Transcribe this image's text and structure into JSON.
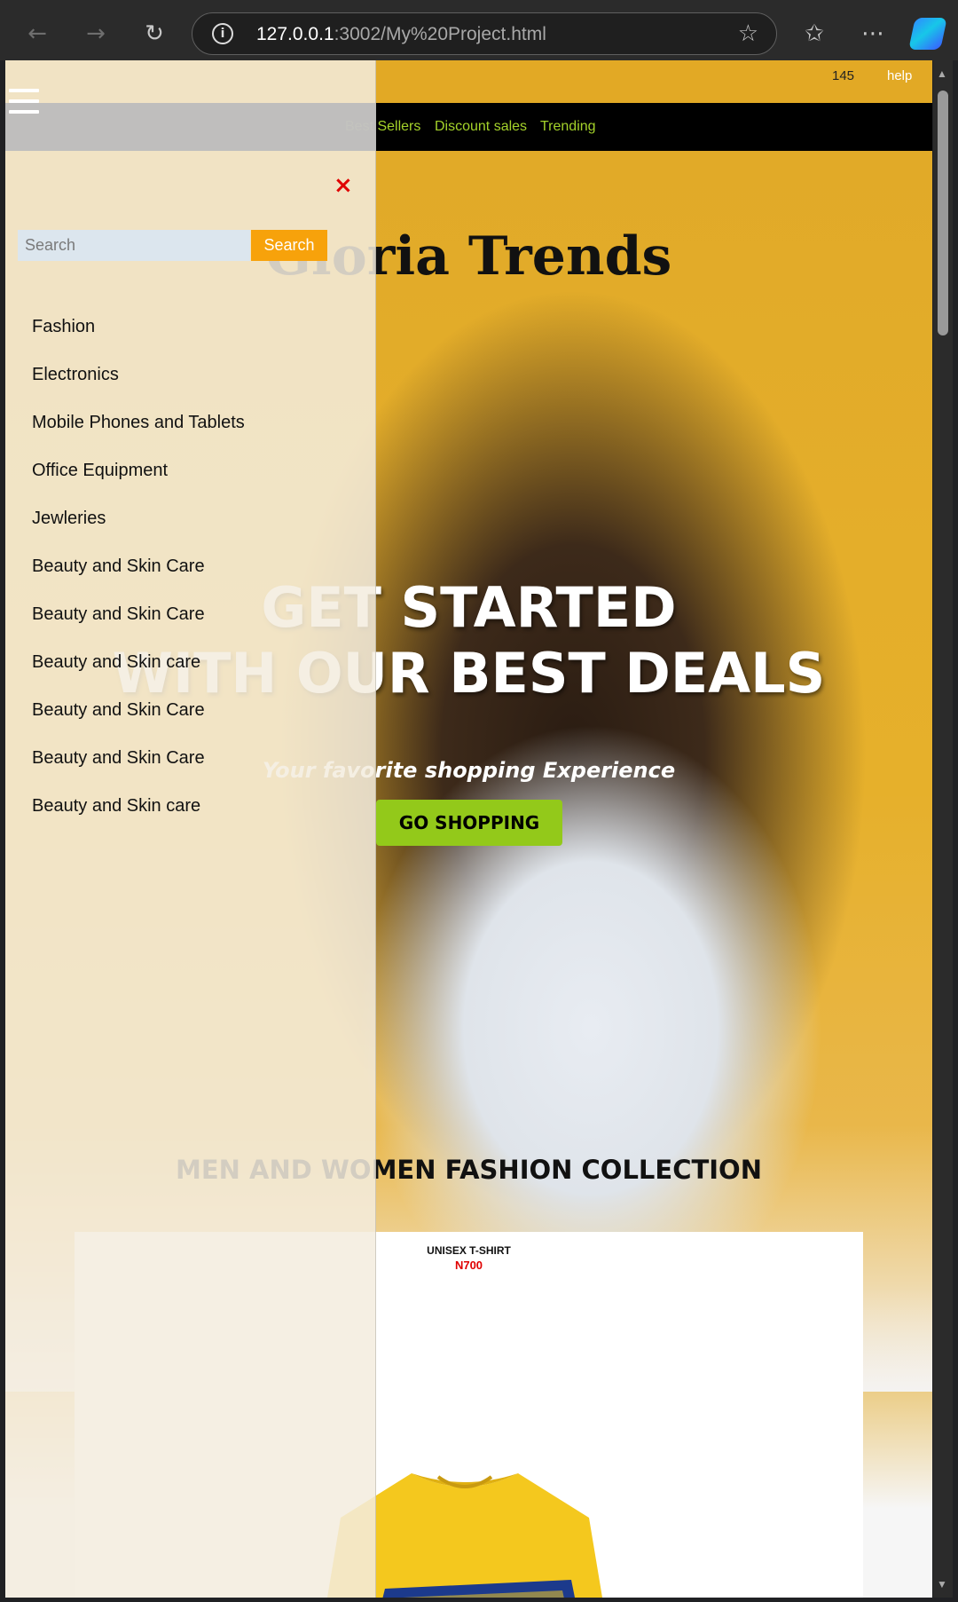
{
  "browser": {
    "url_host": "127.0.0.1",
    "url_path": ":3002/My%20Project.html",
    "icons": [
      "back-icon",
      "forward-icon",
      "refresh-icon",
      "info-icon",
      "favorite-star-icon",
      "favorites-icon",
      "more-icon",
      "copilot-icon"
    ]
  },
  "topbar": {
    "count": "145",
    "help": "help"
  },
  "navbar": {
    "links": [
      "Best Sellers",
      "Discount sales",
      "Trending"
    ]
  },
  "hero": {
    "brand": "Gloria Trends",
    "headline_line1": "GET STARTED",
    "headline_line2": "WITH OUR BEST DEALS",
    "tagline": "Your favorite shopping Experience",
    "cta": "GO SHOPPING"
  },
  "collection": {
    "title": "MEN AND WOMEN FASHION COLLECTION",
    "product": {
      "name": "UNISEX T-SHIRT",
      "price": "N700"
    }
  },
  "side_menu": {
    "close": "×",
    "search_placeholder": "Search",
    "search_button": "Search",
    "categories": [
      "Fashion",
      "Electronics",
      "Mobile Phones and Tablets",
      "Office Equipment",
      "Jewleries",
      "Beauty and Skin Care",
      "Beauty and Skin Care",
      "Beauty and Skin care",
      "Beauty and Skin Care",
      "Beauty and Skin Care",
      "Beauty and Skin care"
    ]
  },
  "colors": {
    "hero_yellow": "#e2a925",
    "nav_link": "#a4d22a",
    "cta_green": "#93c91a",
    "search_orange": "#f7a20b",
    "price_red": "#e00000"
  }
}
